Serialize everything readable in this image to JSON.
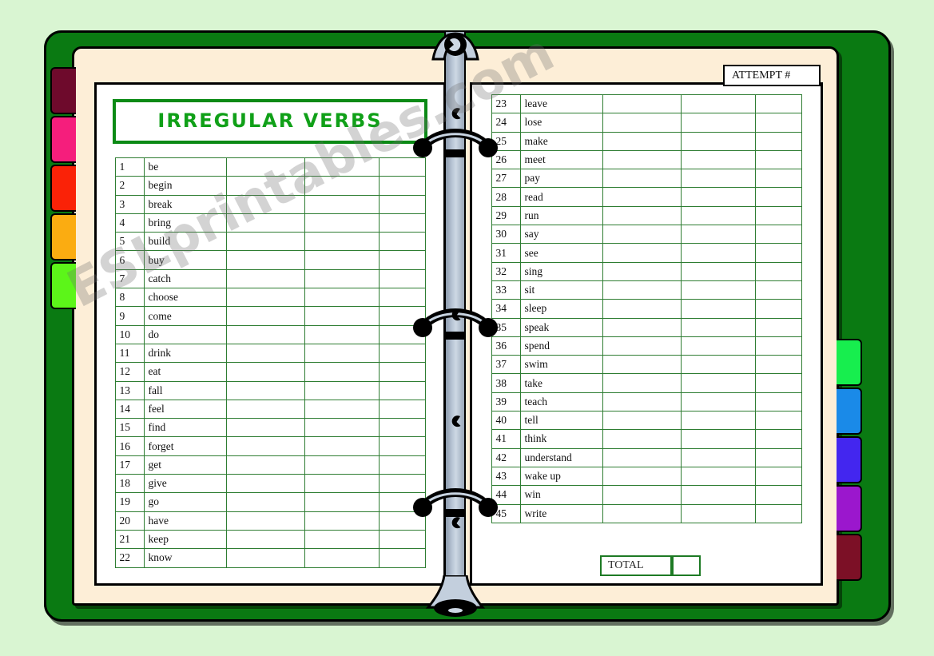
{
  "worksheet": {
    "title": "IRREGULAR VERBS",
    "attempt_label": "ATTEMPT #",
    "total_label": "TOTAL",
    "total_value": "",
    "watermark": "ESLprintables.com"
  },
  "colors": {
    "background": "#d9f5d2",
    "binder_cover": "#0a7a12",
    "page_cream": "#fdeed7",
    "sheet_white": "#ffffff",
    "title_green": "#10a018",
    "grid_green": "#2e7d32",
    "spine_metal": "#b9c6d6"
  },
  "tabs": {
    "left": [
      {
        "name": "tab-maroon",
        "color": "#6e0a2c"
      },
      {
        "name": "tab-pink",
        "color": "#f51e7c"
      },
      {
        "name": "tab-red",
        "color": "#fa2207"
      },
      {
        "name": "tab-orange",
        "color": "#fbac11"
      },
      {
        "name": "tab-green",
        "color": "#5cf519"
      }
    ],
    "right": [
      {
        "name": "tab-green",
        "color": "#17ee4e"
      },
      {
        "name": "tab-blue",
        "color": "#1a8ae8"
      },
      {
        "name": "tab-indigo",
        "color": "#4326ef"
      },
      {
        "name": "tab-purple",
        "color": "#9b17cd"
      },
      {
        "name": "tab-darkred",
        "color": "#7c1026"
      }
    ]
  },
  "table": {
    "columns": [
      "num",
      "verb",
      "blank_a",
      "blank_b",
      "blank_c"
    ],
    "left_page": [
      {
        "num": "1",
        "verb": "be"
      },
      {
        "num": "2",
        "verb": "begin"
      },
      {
        "num": "3",
        "verb": "break"
      },
      {
        "num": "4",
        "verb": "bring"
      },
      {
        "num": "5",
        "verb": "build"
      },
      {
        "num": "6",
        "verb": "buy"
      },
      {
        "num": "7",
        "verb": "catch"
      },
      {
        "num": "8",
        "verb": "choose"
      },
      {
        "num": "9",
        "verb": "come"
      },
      {
        "num": "10",
        "verb": "do"
      },
      {
        "num": "11",
        "verb": "drink"
      },
      {
        "num": "12",
        "verb": "eat"
      },
      {
        "num": "13",
        "verb": "fall"
      },
      {
        "num": "14",
        "verb": "feel"
      },
      {
        "num": "15",
        "verb": "find"
      },
      {
        "num": "16",
        "verb": "forget"
      },
      {
        "num": "17",
        "verb": "get"
      },
      {
        "num": "18",
        "verb": "give"
      },
      {
        "num": "19",
        "verb": "go"
      },
      {
        "num": "20",
        "verb": "have"
      },
      {
        "num": "21",
        "verb": "keep"
      },
      {
        "num": "22",
        "verb": "know"
      }
    ],
    "right_page": [
      {
        "num": "23",
        "verb": "leave"
      },
      {
        "num": "24",
        "verb": "lose"
      },
      {
        "num": "25",
        "verb": "make"
      },
      {
        "num": "26",
        "verb": "meet"
      },
      {
        "num": "27",
        "verb": "pay"
      },
      {
        "num": "28",
        "verb": "read"
      },
      {
        "num": "29",
        "verb": "run"
      },
      {
        "num": "30",
        "verb": "say"
      },
      {
        "num": "31",
        "verb": "see"
      },
      {
        "num": "32",
        "verb": "sing"
      },
      {
        "num": "33",
        "verb": "sit"
      },
      {
        "num": "34",
        "verb": "sleep"
      },
      {
        "num": "35",
        "verb": "speak"
      },
      {
        "num": "36",
        "verb": "spend"
      },
      {
        "num": "37",
        "verb": "swim"
      },
      {
        "num": "38",
        "verb": "take"
      },
      {
        "num": "39",
        "verb": "teach"
      },
      {
        "num": "40",
        "verb": "tell"
      },
      {
        "num": "41",
        "verb": "think"
      },
      {
        "num": "42",
        "verb": "understand"
      },
      {
        "num": "43",
        "verb": "wake up"
      },
      {
        "num": "44",
        "verb": "win"
      },
      {
        "num": "45",
        "verb": "write"
      }
    ]
  }
}
